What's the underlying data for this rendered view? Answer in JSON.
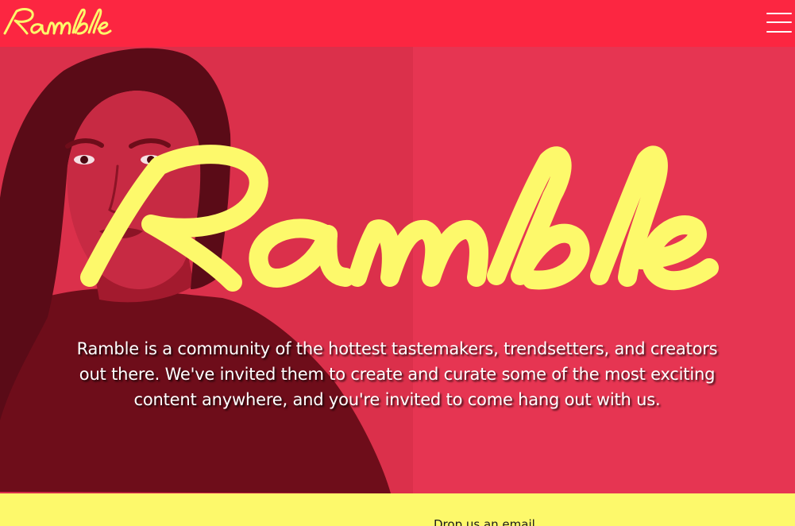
{
  "header": {
    "logo_text": "Ramble",
    "menu_icon": "hamburger-menu-icon"
  },
  "hero": {
    "logo_text": "Ramble",
    "description": "Ramble is a community of the hottest tastemakers, trendsetters, and creators out there. We've invited them to create and curate some of the most exciting content anywhere, and you're invited to come hang out with us."
  },
  "footer": {
    "email_label": "Drop us an email"
  },
  "colors": {
    "header_red": "#fc2641",
    "hero_red": "#e63552",
    "logo_yellow": "#fdf96b",
    "footer_yellow": "#fdf96b"
  }
}
